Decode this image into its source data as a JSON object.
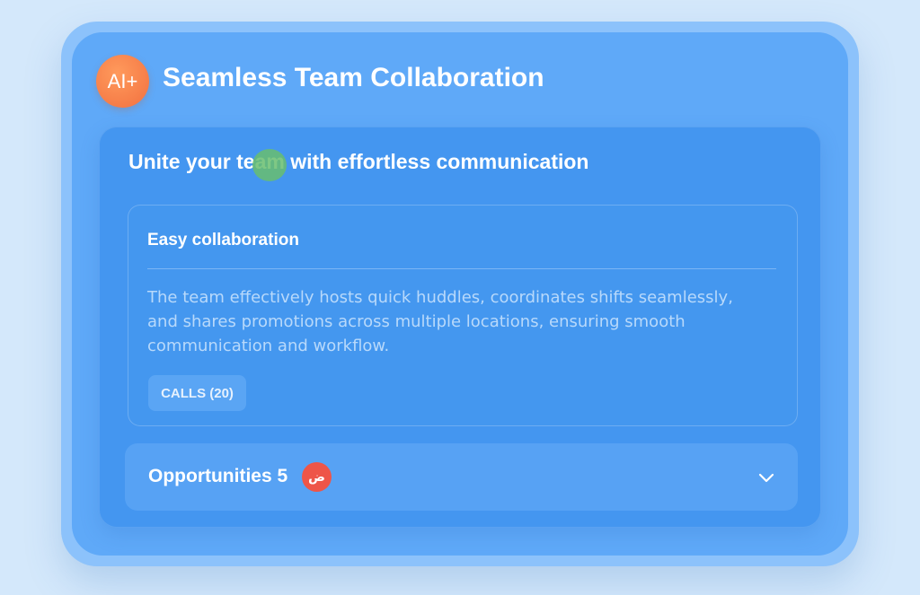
{
  "app": {
    "logo_text": "AI+",
    "title": "Seamless Team Collaboration"
  },
  "panel": {
    "heading": "Unite your team with effortless communication"
  },
  "feature": {
    "title": "Easy collaboration",
    "description": "The team effectively hosts quick huddles, coordinates shifts seamlessly, and shares promotions across multiple locations, ensuring smooth communication and workflow.",
    "chip_label": "CALLS (20)"
  },
  "accordion": {
    "label": "Opportunities 5",
    "badge": "ض",
    "icon": "chevron-down-icon"
  },
  "colors": {
    "background": "#d4e8fb",
    "card": "#5fa9f8",
    "panel": "#4496f0",
    "logo": "#f2703f",
    "badge": "#ee5548",
    "dot": "#68be6e"
  }
}
